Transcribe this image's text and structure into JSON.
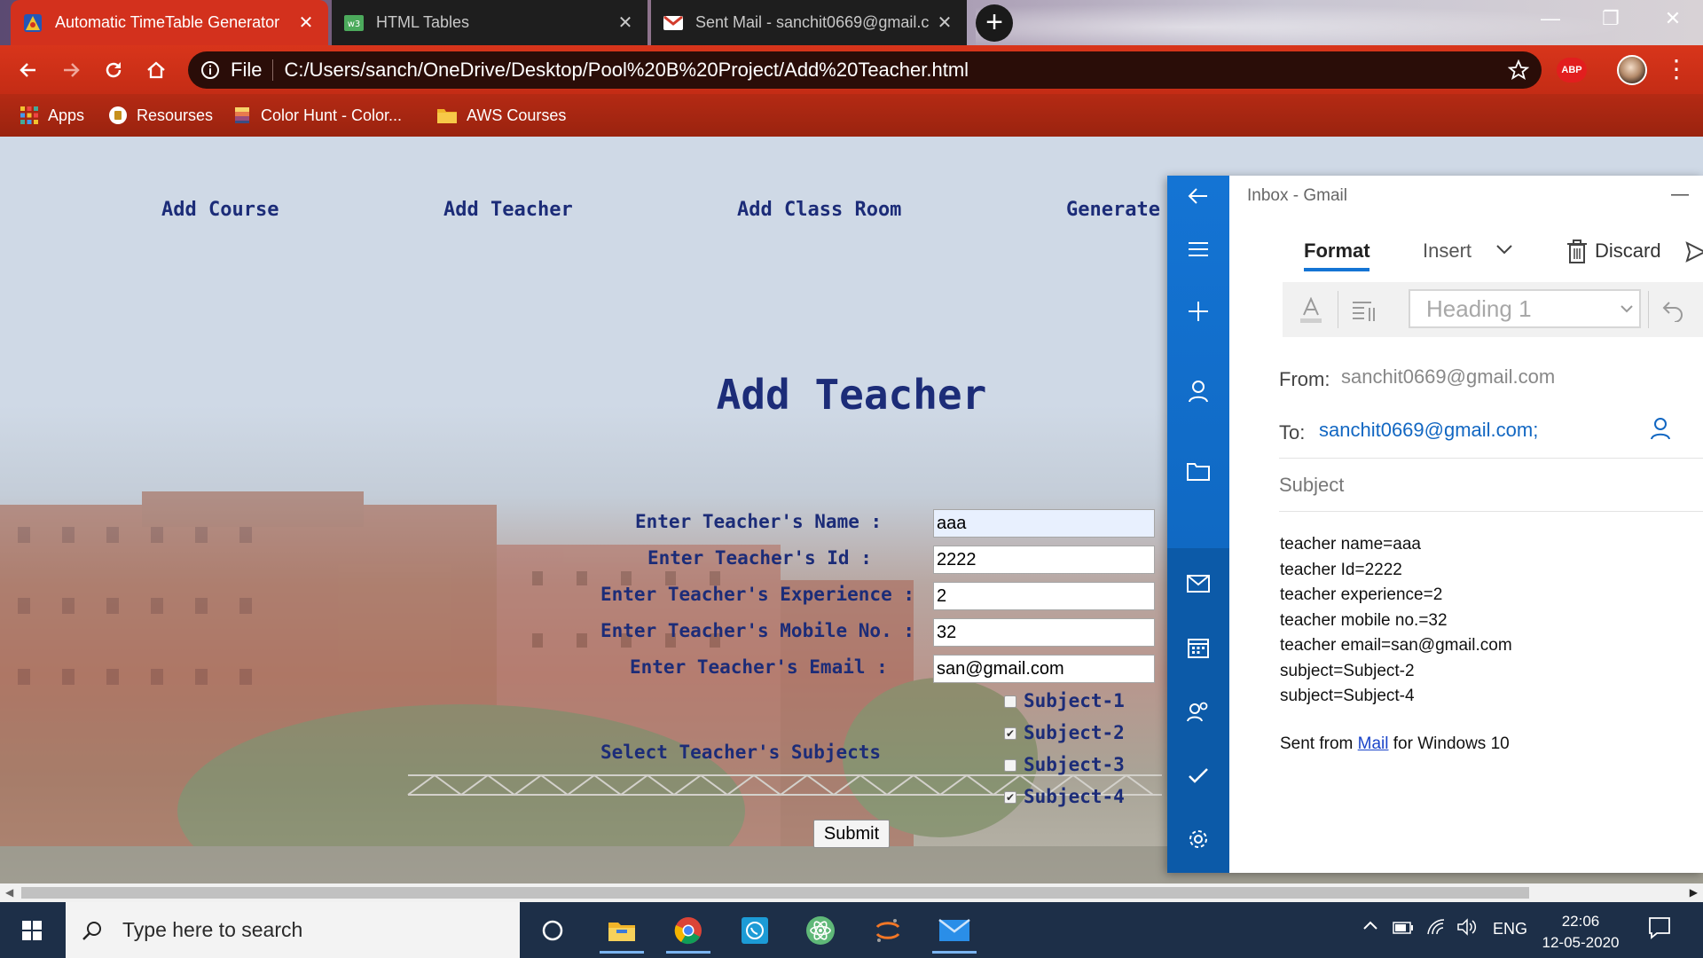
{
  "browser": {
    "tabs": [
      {
        "title": "Automatic TimeTable Generator",
        "icon": "app-logo-icon",
        "active": true
      },
      {
        "title": "HTML Tables",
        "icon": "w3schools-icon",
        "active": false
      },
      {
        "title": "Sent Mail - sanchit0669@gmail.c",
        "icon": "gmail-icon",
        "active": false
      }
    ],
    "omnibox": {
      "security_label": "File",
      "url": "C:/Users/sanch/OneDrive/Desktop/Pool%20B%20Project/Add%20Teacher.html"
    },
    "extension_label": "ABP",
    "bookmarks": [
      {
        "label": "Apps",
        "icon": "apps-grid-icon"
      },
      {
        "label": "Resourses",
        "icon": "bookmark-site-icon"
      },
      {
        "label": "Color Hunt - Color...",
        "icon": "color-hunt-icon"
      },
      {
        "label": "AWS Courses",
        "icon": "folder-icon"
      }
    ]
  },
  "page": {
    "nav": [
      "Add Course",
      "Add Teacher",
      "Add Class Room",
      "Generate"
    ],
    "title": "Add Teacher",
    "form": {
      "fields": [
        {
          "label": "Enter Teacher's Name :",
          "value": "aaa"
        },
        {
          "label": "Enter Teacher's Id :",
          "value": "2222"
        },
        {
          "label": "Enter Teacher's Experience :",
          "value": "2"
        },
        {
          "label": "Enter Teacher's Mobile No. :",
          "value": "32"
        },
        {
          "label": "Enter Teacher's Email :",
          "value": "san@gmail.com"
        }
      ],
      "subjects_label": "Select Teacher's Subjects",
      "subjects": [
        {
          "label": "Subject-1",
          "checked": false
        },
        {
          "label": "Subject-2",
          "checked": true
        },
        {
          "label": "Subject-3",
          "checked": false
        },
        {
          "label": "Subject-4",
          "checked": true
        }
      ],
      "submit_label": "Submit"
    }
  },
  "mail": {
    "window_title": "Inbox - Gmail",
    "tabs": {
      "format": "Format",
      "insert": "Insert",
      "discard": "Discard"
    },
    "style_select": "Heading 1",
    "from_label": "From:",
    "from_value": "sanchit0669@gmail.com",
    "to_label": "To:",
    "to_value": "sanchit0669@gmail.com;",
    "subject_placeholder": "Subject",
    "body_lines": [
      "teacher name=aaa",
      "teacher Id=2222",
      "teacher experience=2",
      "teacher mobile no.=32",
      "teacher email=san@gmail.com",
      "subject=Subject-2",
      "subject=Subject-4"
    ],
    "signature": {
      "prefix": "Sent from ",
      "link": "Mail",
      "suffix": " for Windows 10"
    }
  },
  "taskbar": {
    "search_placeholder": "Type here to search",
    "apps": [
      "cortana-icon",
      "file-explorer-icon",
      "chrome-icon",
      "whatsapp-icon",
      "atom-icon",
      "jupyter-icon",
      "mail-icon"
    ],
    "language": "ENG",
    "time": "22:06",
    "date": "12-05-2020"
  },
  "colors": {
    "chrome_accent": "#d3311d",
    "page_text": "#1c2c78",
    "mail_rail": "#1474d4",
    "taskbar": "#1d2f48"
  }
}
